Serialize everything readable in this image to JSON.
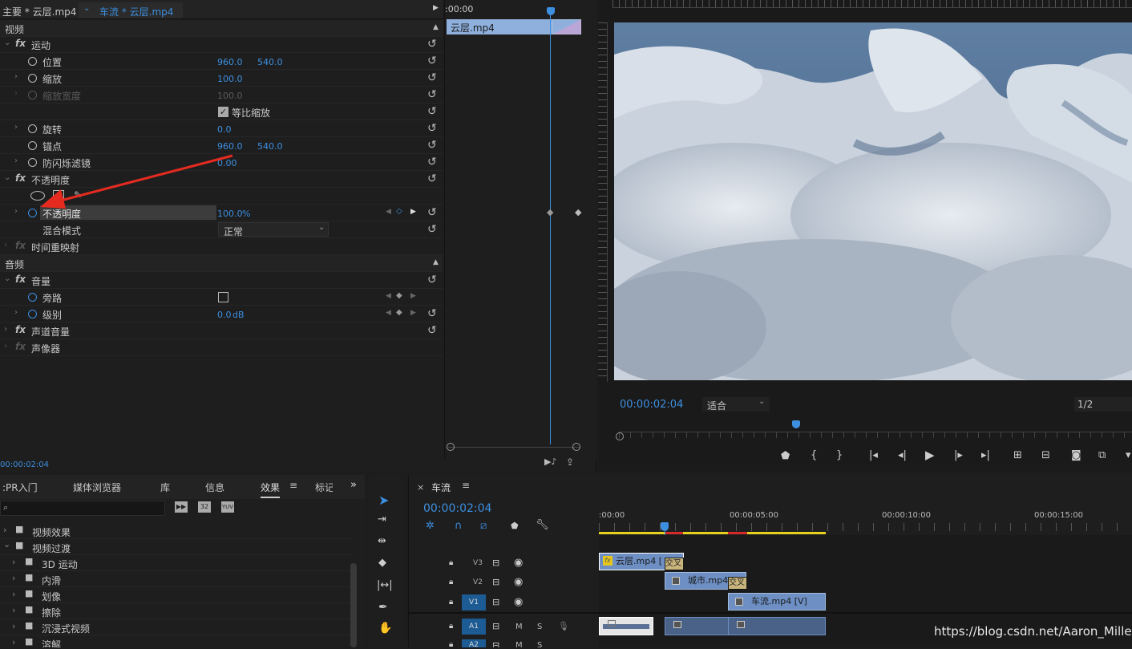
{
  "colors": {
    "accent": "#3d8fe0",
    "clip_blue": "#6d8fc4",
    "yellow_bar": "#e5d21c"
  },
  "ec": {
    "tab_main": "主要 * 云层.mp4",
    "tab_seq": "车流 * 云层.mp4",
    "section_video": "视频",
    "motion": "运动",
    "position": "位置",
    "position_x": "960.0",
    "position_y": "540.0",
    "scale": "缩放",
    "scale_val": "100.0",
    "scale_width": "缩放宽度",
    "scale_width_val": "100.0",
    "uniform_scale": "等比缩放",
    "rotation": "旋转",
    "rotation_val": "0.0",
    "anchor": "锚点",
    "anchor_x": "960.0",
    "anchor_y": "540.0",
    "antiflicker": "防闪烁滤镜",
    "antiflicker_val": "0.00",
    "opacity_group": "不透明度",
    "opacity": "不透明度",
    "opacity_val": "100.0",
    "opacity_unit": "%",
    "blend_mode": "混合模式",
    "blend_mode_val": "正常",
    "time_remap": "时间重映射",
    "section_audio": "音频",
    "volume": "音量",
    "bypass": "旁路",
    "level": "级别",
    "level_val": "0.0",
    "level_unit": "dB",
    "channel_volume": "声道音量",
    "panner": "声像器",
    "timecode": "00:00:02:04",
    "mini_time": ":00:00",
    "mini_clip": "云层.mp4"
  },
  "program": {
    "timecode": "00:00:02:04",
    "fit": "适合",
    "resolution": "1/2"
  },
  "project": {
    "tabs": [
      ":PR入门",
      "媒体浏览器",
      "库",
      "信息",
      "效果",
      "标记"
    ],
    "folders": [
      {
        "label": "视频效果",
        "level": 0
      },
      {
        "label": "视频过渡",
        "level": 0
      },
      {
        "label": "3D 运动",
        "level": 1
      },
      {
        "label": "内滑",
        "level": 1
      },
      {
        "label": "划像",
        "level": 1
      },
      {
        "label": "擦除",
        "level": 1
      },
      {
        "label": "沉浸式视频",
        "level": 1
      },
      {
        "label": "溶解",
        "level": 1
      }
    ]
  },
  "timeline": {
    "close": "×",
    "name": "车流",
    "menu": "≡",
    "timecode": "00:00:02:04",
    "ruler": [
      ":00:00",
      "00:00:05:00",
      "00:00:10:00",
      "00:00:15:00"
    ],
    "tracks": [
      {
        "id": "V3",
        "lock": "🔒"
      },
      {
        "id": "V2",
        "lock": "🔒"
      },
      {
        "id": "V1",
        "lock": "🔒"
      },
      {
        "id": "A1",
        "lock": "🔒",
        "m": "M",
        "s": "S"
      },
      {
        "id": "A2",
        "lock": "🔒",
        "m": "M",
        "s": "S"
      }
    ],
    "clips": {
      "v3": "云层.mp4 [",
      "v2": "城市.mp4 [",
      "v1": "车流.mp4 [V]",
      "trans_v3": "交叉",
      "trans_v2": "交叉"
    }
  },
  "watermark": "https://blog.csdn.net/Aaron_Miller"
}
